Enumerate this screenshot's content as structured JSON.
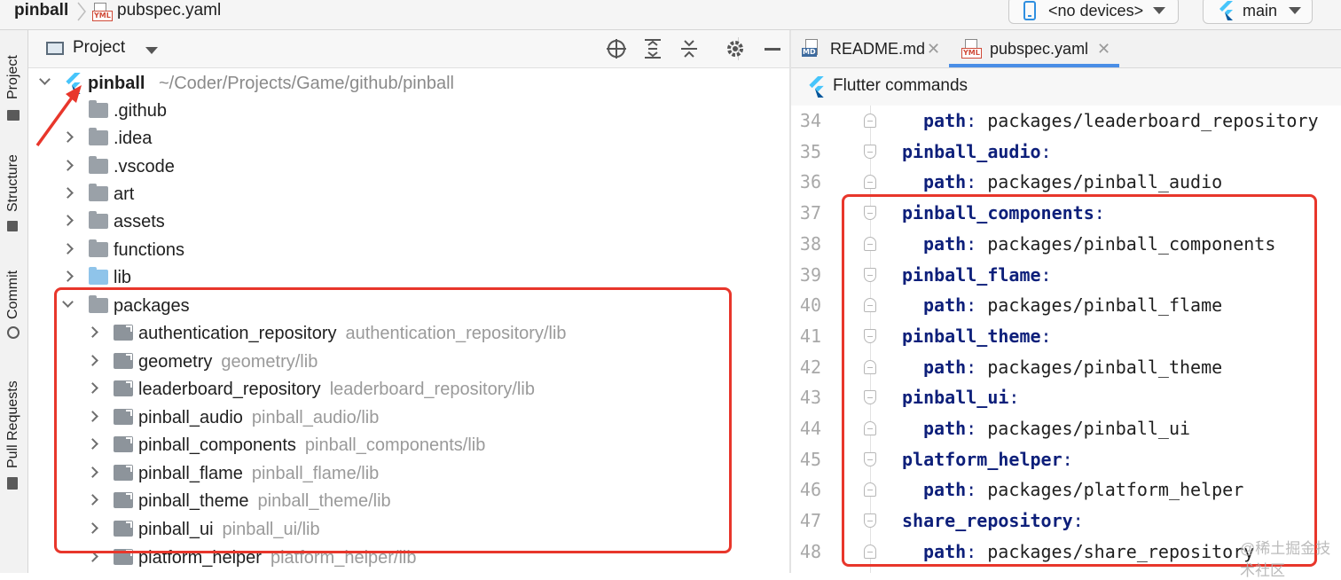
{
  "breadcrumb": {
    "project": "pinball",
    "file": "pubspec.yaml",
    "file_badge": "YML"
  },
  "toolbar": {
    "devices": "<no devices>",
    "branch": "main"
  },
  "left_strip": [
    {
      "label": "Project"
    },
    {
      "label": "Structure"
    },
    {
      "label": "Commit"
    },
    {
      "label": "Pull Requests"
    }
  ],
  "project_panel": {
    "title": "Project",
    "root": {
      "name": "pinball",
      "path": "~/Coder/Projects/Game/github/pinball"
    },
    "items": [
      {
        "name": ".github",
        "expandable": false
      },
      {
        "name": ".idea",
        "expandable": true
      },
      {
        "name": ".vscode",
        "expandable": true
      },
      {
        "name": "art",
        "expandable": true
      },
      {
        "name": "assets",
        "expandable": true
      },
      {
        "name": "functions",
        "expandable": true
      },
      {
        "name": "lib",
        "expandable": true,
        "color": "blue"
      },
      {
        "name": "packages",
        "expandable": true,
        "expanded": true
      }
    ],
    "packages": [
      {
        "name": "authentication_repository",
        "hint": "authentication_repository/lib"
      },
      {
        "name": "geometry",
        "hint": "geometry/lib"
      },
      {
        "name": "leaderboard_repository",
        "hint": "leaderboard_repository/lib"
      },
      {
        "name": "pinball_audio",
        "hint": "pinball_audio/lib"
      },
      {
        "name": "pinball_components",
        "hint": "pinball_components/lib"
      },
      {
        "name": "pinball_flame",
        "hint": "pinball_flame/lib"
      },
      {
        "name": "pinball_theme",
        "hint": "pinball_theme/lib"
      },
      {
        "name": "pinball_ui",
        "hint": "pinball_ui/lib"
      },
      {
        "name": "platform_helper",
        "hint": "platform_helper/lib"
      }
    ]
  },
  "editor": {
    "tabs": [
      {
        "label": "README.md",
        "badge": "MD",
        "active": false
      },
      {
        "label": "pubspec.yaml",
        "badge": "YML",
        "active": true
      }
    ],
    "flutter_commands": "Flutter commands",
    "lines": [
      {
        "num": "34",
        "indent": 1,
        "key": "path",
        "value": " packages/leaderboard_repository"
      },
      {
        "num": "35",
        "indent": 0,
        "key": "pinball_audio",
        "value": ""
      },
      {
        "num": "36",
        "indent": 1,
        "key": "path",
        "value": " packages/pinball_audio"
      },
      {
        "num": "37",
        "indent": 0,
        "key": "pinball_components",
        "value": ""
      },
      {
        "num": "38",
        "indent": 1,
        "key": "path",
        "value": " packages/pinball_components"
      },
      {
        "num": "39",
        "indent": 0,
        "key": "pinball_flame",
        "value": ""
      },
      {
        "num": "40",
        "indent": 1,
        "key": "path",
        "value": " packages/pinball_flame"
      },
      {
        "num": "41",
        "indent": 0,
        "key": "pinball_theme",
        "value": ""
      },
      {
        "num": "42",
        "indent": 1,
        "key": "path",
        "value": " packages/pinball_theme"
      },
      {
        "num": "43",
        "indent": 0,
        "key": "pinball_ui",
        "value": ""
      },
      {
        "num": "44",
        "indent": 1,
        "key": "path",
        "value": " packages/pinball_ui"
      },
      {
        "num": "45",
        "indent": 0,
        "key": "platform_helper",
        "value": ""
      },
      {
        "num": "46",
        "indent": 1,
        "key": "path",
        "value": " packages/platform_helper"
      },
      {
        "num": "47",
        "indent": 0,
        "key": "share_repository",
        "value": ""
      },
      {
        "num": "48",
        "indent": 1,
        "key": "path",
        "value": " packages/share_repository"
      }
    ]
  },
  "watermark": "@稀土掘金技术社区",
  "colors": {
    "highlight_box": "#e8362b",
    "yaml_key": "#0d1f7a",
    "hint_text": "#9a9a9a",
    "active_tab": "#4a8ee6"
  }
}
